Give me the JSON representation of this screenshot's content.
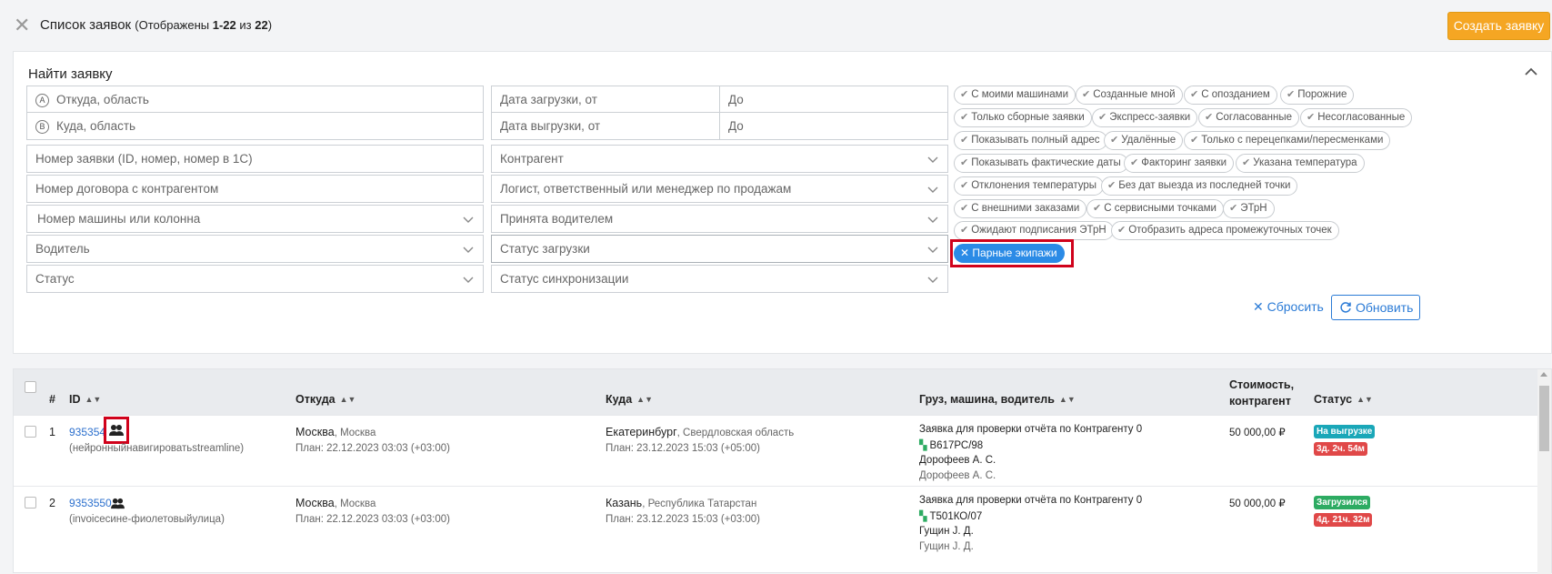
{
  "header": {
    "title": "Список заявок",
    "count_prefix": "(Отображены ",
    "count_range": "1-22",
    "count_of": " из ",
    "count_total": "22",
    "count_suffix": ")",
    "create_button": "Создать заявку"
  },
  "filter": {
    "title": "Найти заявку",
    "from_placeholder": "Откуда, область",
    "from_letter": "A",
    "to_placeholder": "Куда, область",
    "to_letter": "B",
    "load_date_from": "Дата загрузки, от",
    "load_date_to": "До",
    "unload_date_from": "Дата выгрузки, от",
    "unload_date_to": "До",
    "order_number": "Номер заявки (ID, номер, номер в 1С)",
    "contract_number": "Номер договора с контрагентом",
    "vehicle": "Номер машины или колонна",
    "driver": "Водитель",
    "status": "Статус",
    "counterparty": "Контрагент",
    "logist": "Логист, ответственный или менеджер по продажам",
    "accepted_by_driver": "Принята водителем",
    "loading_status": "Статус загрузки",
    "sync_status": "Статус синхронизации",
    "tags": [
      "С моими машинами",
      "Созданные мной",
      "С опозданием",
      "Порожние",
      "Только сборные заявки",
      "Экспресс-заявки",
      "Согласованные",
      "Несогласованные",
      "Показывать полный адрес",
      "Удалённые",
      "Только с перецепками/пересменками",
      "Показывать фактические даты",
      "Факторинг заявки",
      "Указана температура",
      "Отклонения температуры",
      "Без дат выезда из последней точки",
      "С внешними заказами",
      "С сервисными точками",
      "ЭТрН",
      "Ожидают подписания ЭТрН",
      "Отобразить адреса промежуточных точек"
    ],
    "active_tag": "Парные экипажи",
    "reset": "Сбросить",
    "refresh": "Обновить"
  },
  "table": {
    "headers": {
      "num": "#",
      "id": "ID",
      "from": "Откуда",
      "to": "Куда",
      "cargo": "Груз, машина, водитель",
      "cost_line1": "Стоимость,",
      "cost_line2": "контрагент",
      "status": "Статус"
    },
    "rows": [
      {
        "num": "1",
        "id": "935354",
        "sub": "(нейронныйнавигироватьstreamline)",
        "from_city": "Москва",
        "from_region": ", Москва",
        "from_plan": "План: 22.12.2023 03:03 (+03:00)",
        "to_city": "Екатеринбург",
        "to_region": ", Свердловская область",
        "to_plan": "План: 23.12.2023 15:03 (+05:00)",
        "cargo": "Заявка для проверки отчёта по Контрагенту 0",
        "vehicle": "В617РС/98",
        "driver": "Дорофеев А. С.",
        "driver2": "Дорофеев А. С.",
        "cost": "50 000,00 ₽",
        "status": "На выгрузке",
        "status_color": "#1aa7b8",
        "delay": "3д. 2ч. 54м",
        "delay_color": "#e04848"
      },
      {
        "num": "2",
        "id": "9353550",
        "sub": "(invoiceсине-фиолетовыйулица)",
        "from_city": "Москва",
        "from_region": ", Москва",
        "from_plan": "План: 22.12.2023 03:03 (+03:00)",
        "to_city": "Казань",
        "to_region": ", Республика Татарстан",
        "to_plan": "План: 23.12.2023 15:03 (+03:00)",
        "cargo": "Заявка для проверки отчёта по Контрагенту 0",
        "vehicle": "Т501КО/07",
        "driver": "Гущин J. Д.",
        "driver2": "Гущин J. Д.",
        "cost": "50 000,00 ₽",
        "status": "Загрузился",
        "status_color": "#2dab62",
        "delay": "4д. 21ч. 32м",
        "delay_color": "#e04848"
      }
    ]
  }
}
